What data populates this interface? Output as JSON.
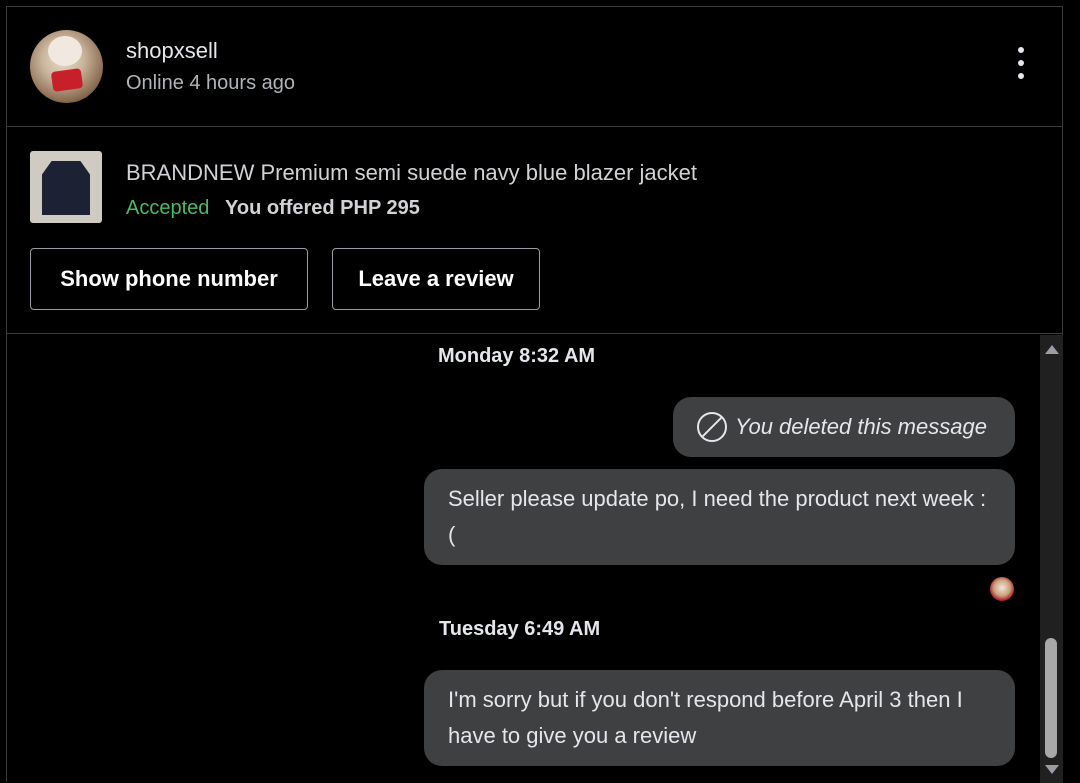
{
  "header": {
    "shop_name": "shopxsell",
    "status": "Online 4 hours ago",
    "menu_icon": "more-vertical-icon"
  },
  "product": {
    "title": "BRANDNEW Premium semi suede navy blue blazer jacket",
    "status": "Accepted",
    "status_color": "#45bd62",
    "offer": "You offered PHP 295",
    "buttons": {
      "phone": "Show phone number",
      "review": "Leave a review"
    }
  },
  "chat": {
    "day1": "Monday  8:32 AM",
    "deleted": "You deleted this message",
    "message1": "Seller please update po, I need the product next week :(",
    "day2": "Tuesday  6:49 AM",
    "message2": "I'm sorry but if you don't respond before April 3 then I have to give you a review"
  },
  "colors": {
    "bubble": "#3e4042",
    "background": "#000000"
  }
}
